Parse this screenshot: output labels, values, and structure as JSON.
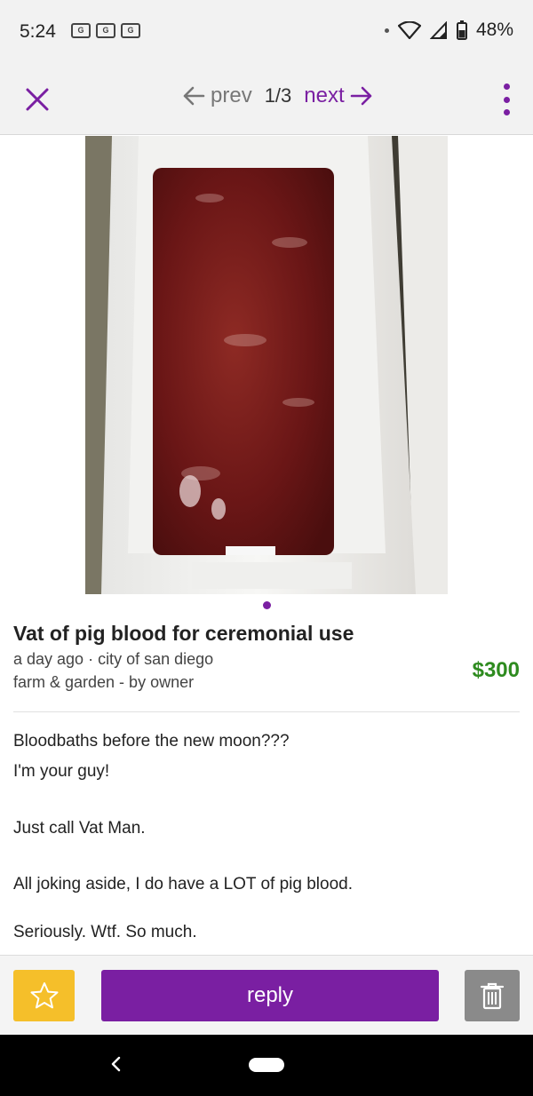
{
  "status_bar": {
    "time": "5:24",
    "notifications": [
      "G",
      "G",
      "G"
    ],
    "battery": "48%"
  },
  "nav": {
    "prev_label": "prev",
    "counter": "1/3",
    "next_label": "next"
  },
  "listing": {
    "title": "Vat of pig blood for ceremonial use",
    "posted": "a day ago · city of san diego",
    "category": "farm & garden - by owner",
    "price": "$300",
    "body": [
      "Bloodbaths before the new moon???",
      "I'm your guy!",
      "Just call Vat Man.",
      "All joking aside, I do have a LOT of pig blood.",
      "Seriously. Wtf. So much."
    ]
  },
  "actions": {
    "reply_label": "reply"
  },
  "colors": {
    "accent": "#7a1fa2",
    "price": "#2e8b1f",
    "favorite": "#f5bf2a",
    "delete": "#8a8a8a"
  },
  "icons": [
    "close-icon",
    "arrow-left-icon",
    "arrow-right-icon",
    "more-vert-icon",
    "star-icon",
    "trash-icon",
    "wifi-icon",
    "signal-icon",
    "battery-icon",
    "nav-back-icon"
  ]
}
